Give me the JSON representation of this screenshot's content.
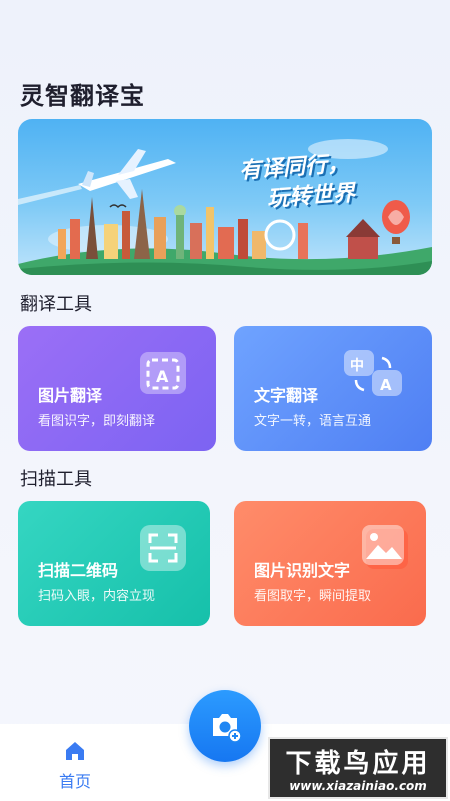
{
  "app": {
    "title": "灵智翻译宝"
  },
  "banner": {
    "slogan_line1": "有译同行，",
    "slogan_line2": "玩转世界"
  },
  "sections": [
    {
      "title": "翻译工具"
    },
    {
      "title": "扫描工具"
    }
  ],
  "tools": {
    "image_translate": {
      "title": "图片翻译",
      "subtitle": "看图识字，即刻翻译",
      "icon": "image-translate-icon"
    },
    "text_translate": {
      "title": "文字翻译",
      "subtitle": "文字一转，语言互通",
      "icon": "text-translate-icon"
    },
    "scan_qr": {
      "title": "扫描二维码",
      "subtitle": "扫码入眼，内容立现",
      "icon": "scan-qr-icon"
    },
    "ocr": {
      "title": "图片识别文字",
      "subtitle": "看图取字，瞬间提取",
      "icon": "image-ocr-icon"
    }
  },
  "bottom_nav": {
    "home_label": "首页",
    "fab_icon": "camera-add-icon"
  },
  "watermark": {
    "title": "下载鸟应用",
    "url": "www.xiazainiao.com"
  },
  "colors": {
    "accent": "#3a7bf2",
    "image_translate": "#8b69f4",
    "text_translate": "#5b8ef6",
    "scan_qr": "#22c9b4",
    "ocr": "#fc7a5a"
  }
}
